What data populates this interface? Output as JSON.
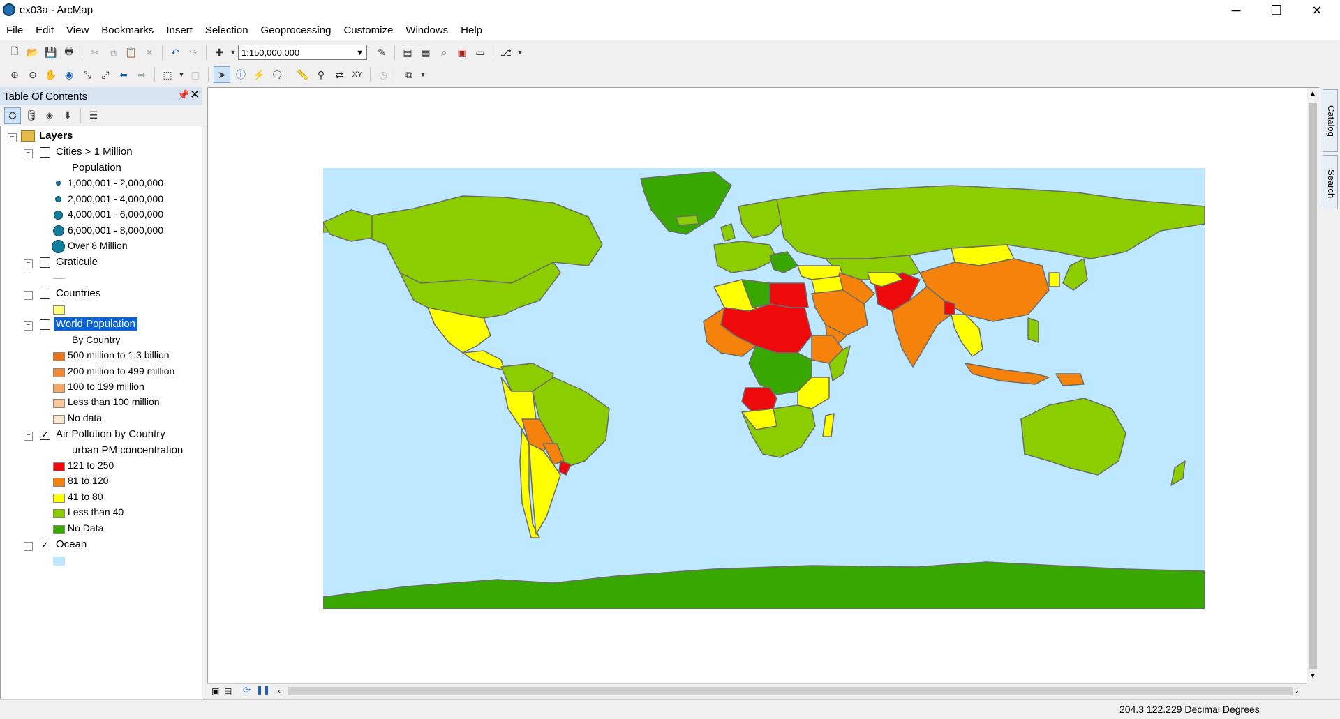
{
  "window": {
    "title": "ex03a - ArcMap",
    "minimize": "─",
    "restore": "❐",
    "close": "✕"
  },
  "menu": [
    "File",
    "Edit",
    "View",
    "Bookmarks",
    "Insert",
    "Selection",
    "Geoprocessing",
    "Customize",
    "Windows",
    "Help"
  ],
  "toolbar": {
    "scale": "1:150,000,000"
  },
  "toc": {
    "title": "Table Of Contents",
    "root": "Layers",
    "cities": {
      "name": "Cities > 1 Million",
      "checked": false,
      "field": "Population",
      "classes": [
        "1,000,001 - 2,000,000",
        "2,000,001 - 4,000,000",
        "4,000,001 - 6,000,000",
        "6,000,001 - 8,000,000",
        "Over 8 Million"
      ]
    },
    "graticule": {
      "name": "Graticule",
      "checked": false
    },
    "countries": {
      "name": "Countries",
      "checked": false,
      "color": "#ffff80"
    },
    "world_population": {
      "name": "World Population",
      "checked": false,
      "selected": true,
      "field": "By Country",
      "classes": [
        {
          "label": "500 million to 1.3 billion",
          "color": "#e8731c"
        },
        {
          "label": "200 million to 499 million",
          "color": "#f08a3a"
        },
        {
          "label": "100 to 199 million",
          "color": "#f5a766"
        },
        {
          "label": "Less than 100 million",
          "color": "#f8c79a"
        },
        {
          "label": "No data",
          "color": "#fbe6cf"
        }
      ]
    },
    "air_pollution": {
      "name": "Air Pollution by Country",
      "checked": true,
      "field": "urban PM concentration",
      "classes": [
        {
          "label": "121 to 250",
          "color": "#ee0a0a"
        },
        {
          "label": "81 to 120",
          "color": "#f5820a"
        },
        {
          "label": "41 to 80",
          "color": "#ffff00"
        },
        {
          "label": "Less than 40",
          "color": "#8ccd00"
        },
        {
          "label": "No Data",
          "color": "#38a800"
        }
      ]
    },
    "ocean": {
      "name": "Ocean",
      "checked": true,
      "color": "#bee8ff"
    }
  },
  "side_tabs": [
    "Catalog",
    "Search"
  ],
  "status": {
    "coords": "204.3  122.229 Decimal Degrees"
  }
}
